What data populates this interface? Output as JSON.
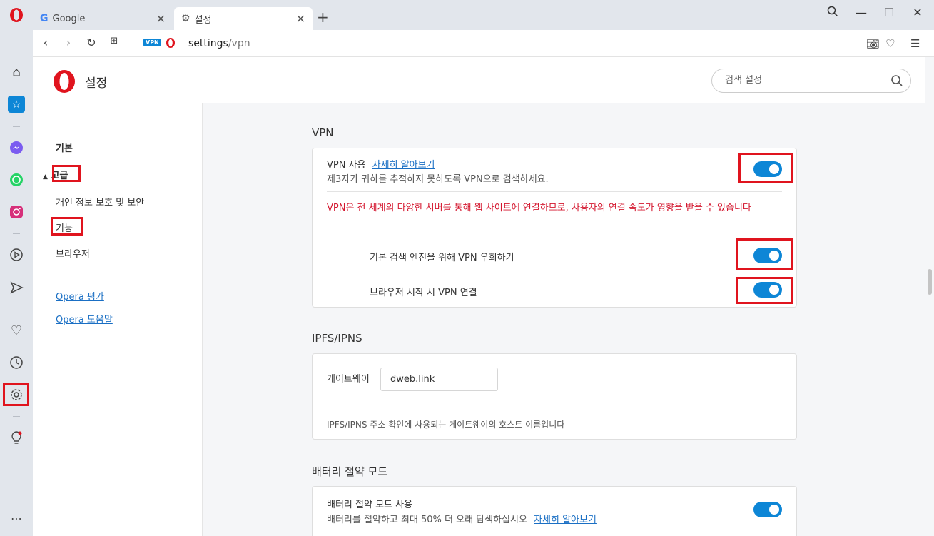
{
  "tabs": [
    {
      "label": "Google",
      "icon": "google-g-icon"
    },
    {
      "label": "설정",
      "icon": "gear-icon"
    }
  ],
  "address": {
    "badge": "VPN",
    "url_host": "settings",
    "url_path": "/vpn"
  },
  "header": {
    "title": "설정",
    "search_placeholder": "검색 설정"
  },
  "nav": {
    "basic": "기본",
    "advanced": "고급",
    "privacy": "개인 정보 보호 및 보안",
    "features": "기능",
    "browser": "브라우저",
    "rate": "Opera 평가",
    "help": "Opera 도움말"
  },
  "vpn": {
    "section_title": "VPN",
    "enable_label": "VPN 사용",
    "learn_more": "자세히 알아보기",
    "enable_desc": "제3자가 귀하를 추적하지 못하도록 VPN으로 검색하세요.",
    "warning": "VPN은 전 세계의 다양한 서버를 통해 웹 사이트에 연결하므로, 사용자의 연결 속도가 영향을 받을 수 있습니다",
    "bypass_label": "기본 검색 엔진을 위해 VPN 우회하기",
    "startup_label": "브라우저 시작 시 VPN 연결",
    "enabled": true,
    "bypass_enabled": true,
    "startup_enabled": true
  },
  "ipfs": {
    "section_title": "IPFS/IPNS",
    "gateway_label": "게이트웨이",
    "gateway_value": "dweb.link",
    "gateway_desc": "IPFS/IPNS 주소 확인에 사용되는 게이트웨이의 호스트 이름입니다"
  },
  "battery": {
    "section_title": "배터리 절약 모드",
    "enable_label": "배터리 절약 모드 사용",
    "desc": "배터리를 절약하고 최대 50% 더 오래 탐색하십시오",
    "learn_more": "자세히 알아보기",
    "enabled": true
  },
  "colors": {
    "accent": "#0d86d6",
    "warning": "#d4172f",
    "highlight": "#e0141e",
    "opera_red": "#e0141e"
  }
}
